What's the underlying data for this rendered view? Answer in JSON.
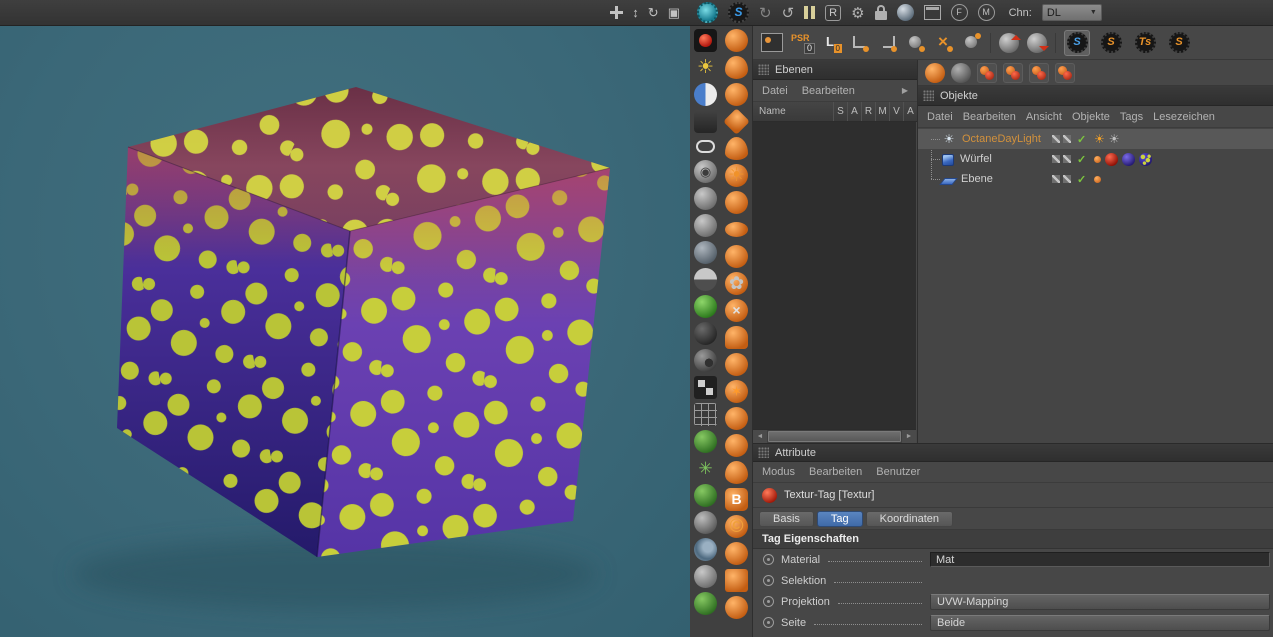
{
  "glyphs": {
    "s": "S",
    "ts": "Ts",
    "refresh": "↻",
    "undo": "↺",
    "gear": "⚙",
    "dropdown_arrow": "▼",
    "submenu_arrow": "▶",
    "scroll_left": "◄",
    "scroll_right": "►",
    "check": "✓",
    "dolly": "↕",
    "orbit": "↻",
    "frame": "▣",
    "sun": "☀"
  },
  "top_toolbar": {
    "r_label": "R",
    "f_label": "F",
    "m_label": "M",
    "chn_label": "Chn:",
    "channel_value": "DL"
  },
  "second_toolbar": {
    "psr_label": "PSR",
    "psr_zero": "0",
    "l_label": "L",
    "l_zero": "0"
  },
  "rails": {
    "left": [
      {
        "name": "render-view-icon",
        "glyph": ""
      },
      {
        "name": "sun-icon",
        "glyph": "☀"
      },
      {
        "name": "contrast-sphere-icon",
        "glyph": ""
      },
      {
        "name": "dark-box-icon",
        "glyph": ""
      },
      {
        "name": "capsule-icon",
        "glyph": ""
      },
      {
        "name": "ring-sphere-icon",
        "glyph": "◉"
      },
      {
        "name": "gray-sphere-icon",
        "glyph": ""
      },
      {
        "name": "gray-sphere-2-icon",
        "glyph": ""
      },
      {
        "name": "gray-sphere-3-icon",
        "glyph": ""
      },
      {
        "name": "half-sphere-icon",
        "glyph": ""
      },
      {
        "name": "recycle-sphere-icon",
        "glyph": ""
      },
      {
        "name": "dark-sphere-icon",
        "glyph": ""
      },
      {
        "name": "pattern-sphere-icon",
        "glyph": ""
      },
      {
        "name": "film-icon",
        "glyph": ""
      },
      {
        "name": "grid-icon",
        "glyph": ""
      },
      {
        "name": "plants-icon",
        "glyph": ""
      },
      {
        "name": "scatter-icon",
        "glyph": "✳"
      },
      {
        "name": "grass-icon",
        "glyph": ""
      },
      {
        "name": "knot-icon",
        "glyph": ""
      },
      {
        "name": "swirl-icon",
        "glyph": ""
      },
      {
        "name": "pebble-icon",
        "glyph": ""
      },
      {
        "name": "tree-icon",
        "glyph": ""
      }
    ],
    "right": [
      {
        "name": "octane-orb-icon",
        "glyph": ""
      },
      {
        "name": "flame-icon",
        "glyph": ""
      },
      {
        "name": "terrain-sphere-icon",
        "glyph": ""
      },
      {
        "name": "diamond-icon",
        "glyph": ""
      },
      {
        "name": "fish-icon",
        "glyph": ""
      },
      {
        "name": "orange-sun-icon",
        "glyph": "☀"
      },
      {
        "name": "waffle-sphere-icon",
        "glyph": ""
      },
      {
        "name": "eye-icon",
        "glyph": ""
      },
      {
        "name": "orange-sphere-icon",
        "glyph": ""
      },
      {
        "name": "flower-icon",
        "glyph": "✿"
      },
      {
        "name": "x-sphere-icon",
        "glyph": "×"
      },
      {
        "name": "dome-icon",
        "glyph": ""
      },
      {
        "name": "orange-sphere-2-icon",
        "glyph": ""
      },
      {
        "name": "burst-icon",
        "glyph": "✶"
      },
      {
        "name": "peach-sphere-icon",
        "glyph": ""
      },
      {
        "name": "red-sphere-icon",
        "glyph": ""
      },
      {
        "name": "flame-2-icon",
        "glyph": ""
      },
      {
        "name": "b-badge-icon",
        "glyph": "B"
      },
      {
        "name": "copyright-icon",
        "glyph": "©"
      },
      {
        "name": "crescent-icon",
        "glyph": ""
      },
      {
        "name": "stack-icon",
        "glyph": ""
      },
      {
        "name": "fern-icon",
        "glyph": ""
      }
    ],
    "objekte_toolbar": [
      {
        "name": "add-material-icon",
        "glyph": ""
      },
      {
        "name": "add-mix-material-icon",
        "glyph": ""
      },
      {
        "name": "material-pair-1-icon",
        "glyph": ""
      },
      {
        "name": "material-pair-2-icon",
        "glyph": ""
      },
      {
        "name": "material-pair-3-icon",
        "glyph": ""
      },
      {
        "name": "material-pair-4-icon",
        "glyph": ""
      }
    ]
  },
  "ebenen": {
    "title": "Ebenen",
    "menu": [
      "Datei",
      "Bearbeiten"
    ],
    "columns": [
      "Name",
      "S",
      "A",
      "R",
      "M",
      "V",
      "A"
    ]
  },
  "objekte": {
    "title": "Objekte",
    "menu": [
      "Datei",
      "Bearbeiten",
      "Ansicht",
      "Objekte",
      "Tags",
      "Lesezeichen"
    ],
    "items": [
      {
        "label": "OctaneDayLight"
      },
      {
        "label": "Würfel"
      },
      {
        "label": "Ebene"
      }
    ]
  },
  "attribute": {
    "title": "Attribute",
    "menu": [
      "Modus",
      "Bearbeiten",
      "Benutzer"
    ],
    "object_label": "Textur-Tag [Textur]",
    "tabs": [
      "Basis",
      "Tag",
      "Koordinaten"
    ],
    "active_tab": "Tag",
    "section_title": "Tag Eigenschaften",
    "rows": [
      {
        "label": "Material",
        "value": "Mat"
      },
      {
        "label": "Selektion",
        "value": ""
      },
      {
        "label": "Projektion",
        "value": "UVW-Mapping"
      },
      {
        "label": "Seite",
        "value": "Beide"
      }
    ]
  }
}
